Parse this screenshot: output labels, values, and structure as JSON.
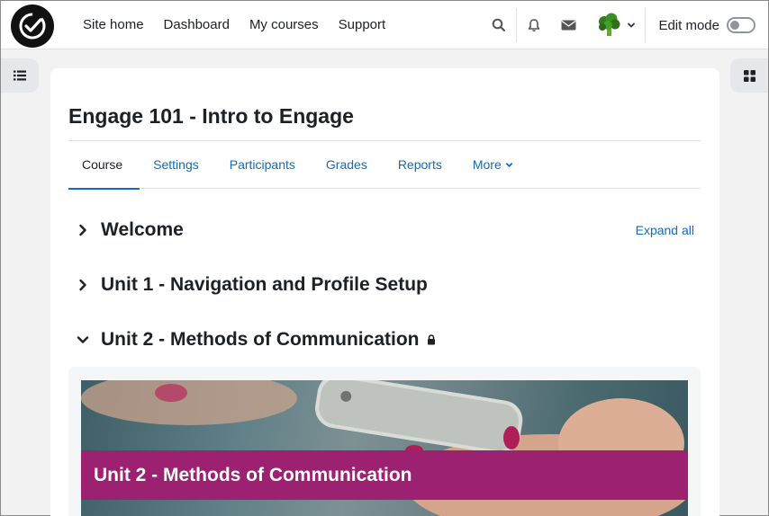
{
  "navbar": {
    "links": [
      "Site home",
      "Dashboard",
      "My courses",
      "Support"
    ],
    "edit_mode_label": "Edit mode",
    "edit_mode_on": false,
    "icons": [
      "search-icon",
      "bell-icon",
      "envelope-icon",
      "chevron-down-icon"
    ]
  },
  "course": {
    "title": "Engage 101 - Intro to Engage",
    "tabs": [
      "Course",
      "Settings",
      "Participants",
      "Grades",
      "Reports",
      "More"
    ],
    "active_tab": "Course",
    "expand_all": "Expand all",
    "sections": [
      {
        "title": "Welcome",
        "expanded": false,
        "locked": false
      },
      {
        "title": "Unit 1 - Navigation and Profile Setup",
        "expanded": false,
        "locked": false
      },
      {
        "title": "Unit 2 - Methods of Communication",
        "expanded": true,
        "locked": true
      }
    ],
    "banner_caption": "Unit 2 - Methods of Communication"
  },
  "colors": {
    "link": "#0f6cbf",
    "banner_caption_bg": "#9c2170"
  }
}
